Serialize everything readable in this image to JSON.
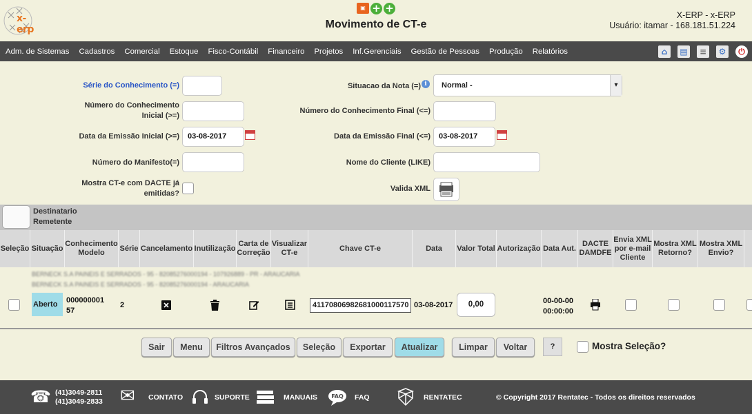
{
  "header": {
    "title": "Movimento de CT-e",
    "user_line1": "X-ERP - x-ERP",
    "user_line2": "Usuário: itamar - 168.181.51.224",
    "logo_text": "x-erp"
  },
  "nav": {
    "items": [
      "Adm. de Sistemas",
      "Cadastros",
      "Comercial",
      "Estoque",
      "Fisco-Contábil",
      "Financeiro",
      "Projetos",
      "Inf.Gerenciais",
      "Gestão de Pessoas",
      "Produção",
      "Relatórios"
    ]
  },
  "filters": {
    "serie_label": "Série do Conhecimento (=)",
    "numero_inicial_label": "Número do Conhecimento Inicial (>=)",
    "data_inicial_label": "Data da Emissão Inicial (>=)",
    "data_inicial_value": "03-08-2017",
    "manifesto_label": "Número do Manifesto(=)",
    "dacte_label": "Mostra CT-e com DACTE já emitidas?",
    "situacao_label": "Situacao da Nota (=)",
    "situacao_value": "Normal -",
    "numero_final_label": "Número do Conhecimento Final (<=)",
    "data_final_label": "Data da Emissão Final (<=)",
    "data_final_value": "03-08-2017",
    "cliente_label": "Nome do Cliente (LIKE)",
    "valida_xml_label": "Valida XML"
  },
  "group_bar": {
    "line1": "Destinatario",
    "line2": "Remetente"
  },
  "table": {
    "headers": [
      "Seleção",
      "Situação",
      "Conhecimento Modelo",
      "Série",
      "Cancelamento",
      "Inutilização",
      "Carta de Correção",
      "Visualizar CT-e",
      "Chave CT-e",
      "Data",
      "Valor Total",
      "Autorização",
      "Data Aut.",
      "DACTE DAMDFE",
      "Envia XML por e-mail Cliente",
      "Mostra XML Retorno?",
      "Mostra XML Envio?"
    ],
    "row": {
      "situacao": "Aberto",
      "conhecimento_line1": "000000001",
      "conhecimento_line2": "57",
      "serie": "2",
      "chave": "41170806982681000117570",
      "data": "03-08-2017",
      "valor": "0,00",
      "data_aut_line1": "00-00-00",
      "data_aut_line2": "00:00:00",
      "blur_line1": "BERNECK S.A PAINEIS E SERRADOS - 95 - 82085276000194 - 107926889 - PR - ARAUCARIA",
      "blur_line2": "BERNECK S.A PAINEIS E SERRADOS - 95 - 82085276000194 - ARAUCARIA"
    }
  },
  "buttons": {
    "sair": "Sair",
    "menu": "Menu",
    "filtros": "Filtros Avançados",
    "selecao": "Seleção",
    "exportar": "Exportar",
    "atualizar": "Atualizar",
    "limpar": "Limpar",
    "voltar": "Voltar",
    "help": "?",
    "mostra_selecao": "Mostra Seleção?"
  },
  "footer": {
    "phone1": "(41)3049-2811",
    "phone2": "(41)3049-2833",
    "contato": "CONTATO",
    "suporte": "SUPORTE",
    "manuais": "MANUAIS",
    "faq": "FAQ",
    "rentatec": "RENTATEC",
    "copyright": "© Copyright 2017 Rentatec - Todos os direitos reservados"
  },
  "colors": {
    "accent": "#9fdce8",
    "nav_bg": "#4a4a4a",
    "page_bg": "#f2f1dd"
  }
}
